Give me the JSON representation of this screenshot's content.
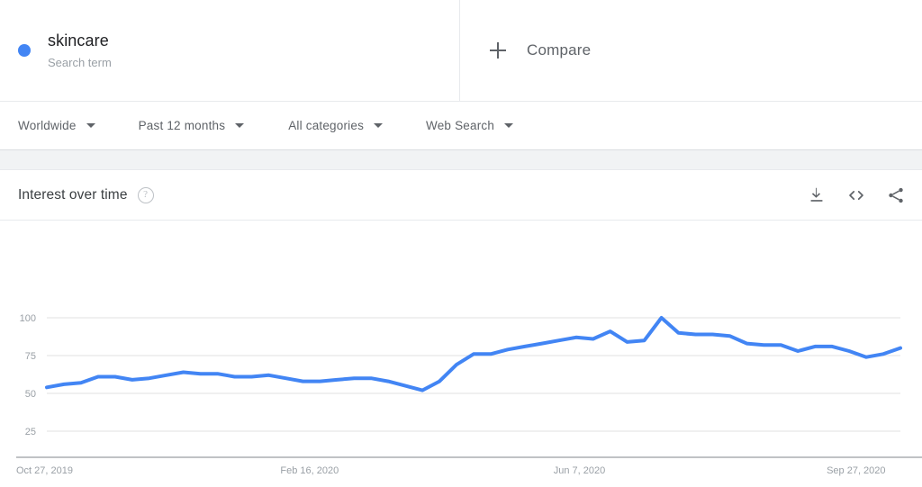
{
  "search_term": {
    "name": "skincare",
    "type_label": "Search term",
    "dot_color": "#4285f4"
  },
  "compare": {
    "label": "Compare",
    "icon": "plus-icon"
  },
  "filters": [
    {
      "label": "Worldwide",
      "icon": "chevron-down-icon"
    },
    {
      "label": "Past 12 months",
      "icon": "chevron-down-icon"
    },
    {
      "label": "All categories",
      "icon": "chevron-down-icon"
    },
    {
      "label": "Web Search",
      "icon": "chevron-down-icon"
    }
  ],
  "card": {
    "title": "Interest over time",
    "help_icon": "?",
    "actions": [
      {
        "name": "download-icon",
        "label": "Download"
      },
      {
        "name": "embed-code-icon",
        "label": "Embed"
      },
      {
        "name": "share-icon",
        "label": "Share"
      }
    ]
  },
  "chart_data": {
    "type": "line",
    "title": "Interest over time",
    "xlabel": "",
    "ylabel": "",
    "ylim": [
      0,
      106
    ],
    "yticks": [
      25,
      50,
      75,
      100
    ],
    "grid": true,
    "legend": false,
    "line_color": "#4285f4",
    "xticks": [
      "Oct 27, 2019",
      "Feb 16, 2020",
      "Jun 7, 2020",
      "Sep 27, 2020"
    ],
    "xtick_indices": [
      0,
      16,
      32,
      48
    ],
    "x": [
      "Oct 27, 2019",
      "Nov 3, 2019",
      "Nov 10, 2019",
      "Nov 17, 2019",
      "Nov 24, 2019",
      "Dec 1, 2019",
      "Dec 8, 2019",
      "Dec 15, 2019",
      "Dec 22, 2019",
      "Dec 29, 2019",
      "Jan 5, 2020",
      "Jan 12, 2020",
      "Jan 19, 2020",
      "Jan 26, 2020",
      "Feb 2, 2020",
      "Feb 9, 2020",
      "Feb 16, 2020",
      "Feb 23, 2020",
      "Mar 1, 2020",
      "Mar 8, 2020",
      "Mar 15, 2020",
      "Mar 22, 2020",
      "Mar 29, 2020",
      "Apr 5, 2020",
      "Apr 12, 2020",
      "Apr 19, 2020",
      "Apr 26, 2020",
      "May 3, 2020",
      "May 10, 2020",
      "May 17, 2020",
      "May 24, 2020",
      "May 31, 2020",
      "Jun 7, 2020",
      "Jun 14, 2020",
      "Jun 21, 2020",
      "Jun 28, 2020",
      "Jul 5, 2020",
      "Jul 12, 2020",
      "Jul 19, 2020",
      "Jul 26, 2020",
      "Aug 2, 2020",
      "Aug 9, 2020",
      "Aug 16, 2020",
      "Aug 23, 2020",
      "Aug 30, 2020",
      "Sep 6, 2020",
      "Sep 13, 2020",
      "Sep 20, 2020",
      "Sep 27, 2020",
      "Oct 4, 2020",
      "Oct 11, 2020"
    ],
    "values": [
      54,
      56,
      57,
      61,
      61,
      59,
      60,
      62,
      64,
      63,
      63,
      61,
      61,
      62,
      60,
      58,
      58,
      59,
      60,
      60,
      58,
      55,
      52,
      58,
      69,
      76,
      76,
      79,
      81,
      83,
      85,
      87,
      86,
      91,
      84,
      85,
      100,
      90,
      89,
      89,
      88,
      83,
      82,
      82,
      78,
      81,
      81,
      78,
      74,
      76,
      80
    ]
  }
}
